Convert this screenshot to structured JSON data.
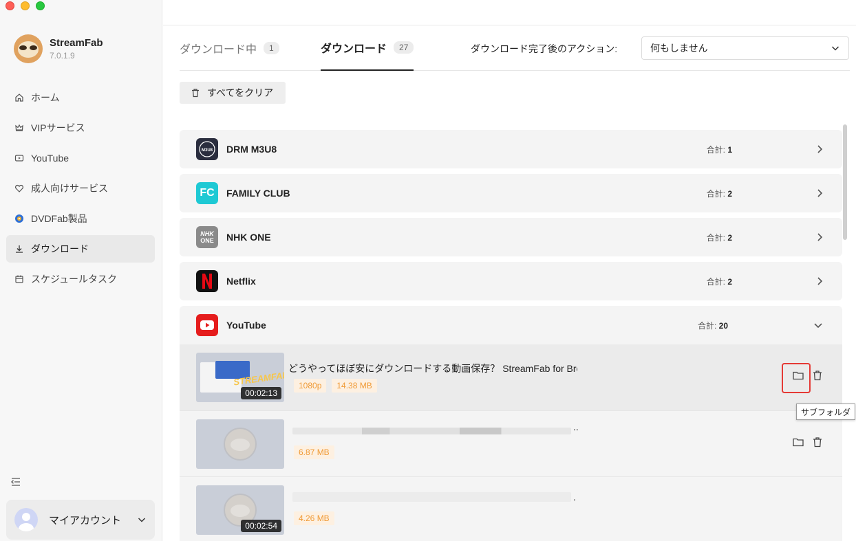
{
  "app": {
    "name": "StreamFab",
    "version": "7.0.1.9"
  },
  "sidebar": {
    "items": [
      {
        "label": "ホーム",
        "icon": "home-icon"
      },
      {
        "label": "VIPサービス",
        "icon": "crown-icon"
      },
      {
        "label": "YouTube",
        "icon": "youtube-icon"
      },
      {
        "label": "成人向けサービス",
        "icon": "heart-icon"
      },
      {
        "label": "DVDFab製品",
        "icon": "dvdfab-icon"
      },
      {
        "label": "ダウンロード",
        "icon": "download-icon",
        "active": true
      },
      {
        "label": "スケジュールタスク",
        "icon": "calendar-icon"
      }
    ],
    "account_label": "マイアカウント"
  },
  "tabs": [
    {
      "label": "ダウンロード中",
      "count": "1",
      "active": false
    },
    {
      "label": "ダウンロード",
      "count": "27",
      "active": true
    }
  ],
  "post_action": {
    "label": "ダウンロード完了後のアクション:",
    "value": "何もしません"
  },
  "clear_all_label": "すべてをクリア",
  "total_prefix": "合計:",
  "groups": [
    {
      "name": "DRM M3U8",
      "total": "1",
      "logo_text": "DRM M3U8",
      "logo_color": "#2a2d3e"
    },
    {
      "name": "FAMILY CLUB",
      "total": "2",
      "logo_text": "FC",
      "logo_color": "#1ec9d4"
    },
    {
      "name": "NHK ONE",
      "total": "2",
      "logo_text": "NHK ONE",
      "logo_color": "#8a8a8a"
    },
    {
      "name": "Netflix",
      "total": "2",
      "logo_text": "N",
      "logo_color": "#111111"
    },
    {
      "name": "YouTube",
      "total": "20",
      "logo_text": "▶",
      "logo_color": "#e51c1c",
      "expanded": true
    }
  ],
  "youtube_items": [
    {
      "title": "どうやってほぼ安にダウンロードする動画保存？ StreamFab for Brow",
      "resolution": "1080p",
      "size": "14.38 MB",
      "duration": "00:02:13"
    },
    {
      "title": "..",
      "resolution": "",
      "size": "6.87 MB",
      "duration": ""
    },
    {
      "title": ".",
      "resolution": "",
      "size": "4.26 MB",
      "duration": "00:02:54"
    }
  ],
  "thumbnail_text": "STREAMFAB",
  "tooltip": "サブフォルダ",
  "colors": {
    "accent_orange": "#f09a35",
    "highlight_red": "#e53935"
  }
}
